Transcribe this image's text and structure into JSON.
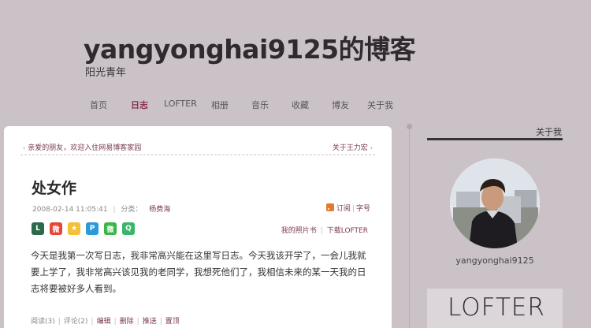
{
  "header": {
    "title": "yangyonghai9125的博客",
    "subtitle": "阳光青年"
  },
  "nav": {
    "items": [
      {
        "label": "首页",
        "active": false
      },
      {
        "label": "日志",
        "active": true
      },
      {
        "label": "LOFTER",
        "active": false
      },
      {
        "label": "相册",
        "active": false
      },
      {
        "label": "音乐",
        "active": false
      },
      {
        "label": "收藏",
        "active": false
      },
      {
        "label": "博友",
        "active": false
      },
      {
        "label": "关于我",
        "active": false
      }
    ]
  },
  "post": {
    "prev_link": "亲爱的朋友，欢迎入住网易博客家园",
    "next_link": "关于王力宏",
    "title": "处女作",
    "datetime": "2008-02-14 11:05:41",
    "category_label": "分类：",
    "category": "杨费海",
    "subscribe": "订阅",
    "font_size": "字号",
    "my_photos": "我的照片书",
    "download_lofter": "下载LOFTER",
    "content": "今天是我第一次写日志，我非常高兴能在这里写日志。今天我该开学了，一会儿我就要上学了，我非常高兴该见我的老同学，我想死他们了，我相信未来的某一天我的日志将要被好多人看到。",
    "reads_label": "阅读(3)",
    "comments_label": "评论(2)",
    "edit": "编辑",
    "delete": "删除",
    "recommend": "推送",
    "pin": "置顶"
  },
  "sidebar": {
    "about_title": "关于我",
    "username": "yangyonghai9125",
    "lofter_logo": "LOFTER"
  },
  "share_icons": [
    "lofter-share-icon",
    "weibo-share-icon",
    "star-share-icon",
    "friend-share-icon",
    "wechat-share-icon",
    "qzone-share-icon"
  ]
}
